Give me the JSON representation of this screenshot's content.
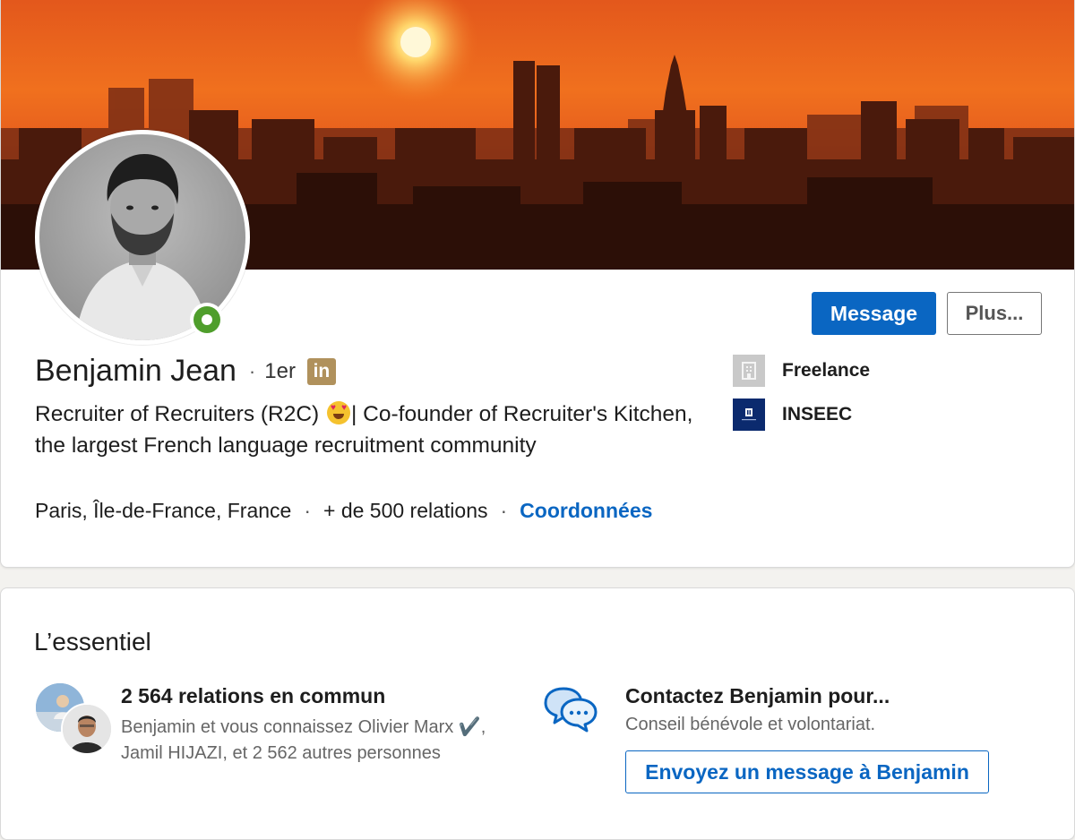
{
  "profile": {
    "name": "Benjamin Jean",
    "separator": "·",
    "degree": "1er",
    "badge_text": "in",
    "headline_part1": "Recruiter of Recruiters (R2C) ",
    "headline_part2": "| Co-founder of Recruiter's Kitchen, the largest French language recruitment community",
    "location": "Paris, Île-de-France, France",
    "connections": "+ de 500 relations",
    "contact_link": "Coordonnées",
    "presence_status": "online",
    "companies": [
      {
        "name": "Freelance",
        "logo_icon": "building-icon"
      },
      {
        "name": "INSEEC",
        "logo_icon": "inseec-logo"
      }
    ]
  },
  "actions": {
    "message_label": "Message",
    "more_label": "Plus..."
  },
  "essentials": {
    "title": "L’essentiel",
    "mutual": {
      "title": "2 564 relations en commun",
      "text": "Benjamin et vous connaissez Olivier Marx ✔️, Jamil HIJAZI, et 2 562 autres personnes"
    },
    "contact": {
      "title": "Contactez Benjamin pour...",
      "text": "Conseil bénévole et volontariat.",
      "button_label": "Envoyez un message à Benjamin"
    }
  },
  "colors": {
    "accent": "#0a66c2",
    "presence": "#4f9e2c",
    "premium_badge": "#b0915c",
    "banner_sky": "#e8541a"
  }
}
